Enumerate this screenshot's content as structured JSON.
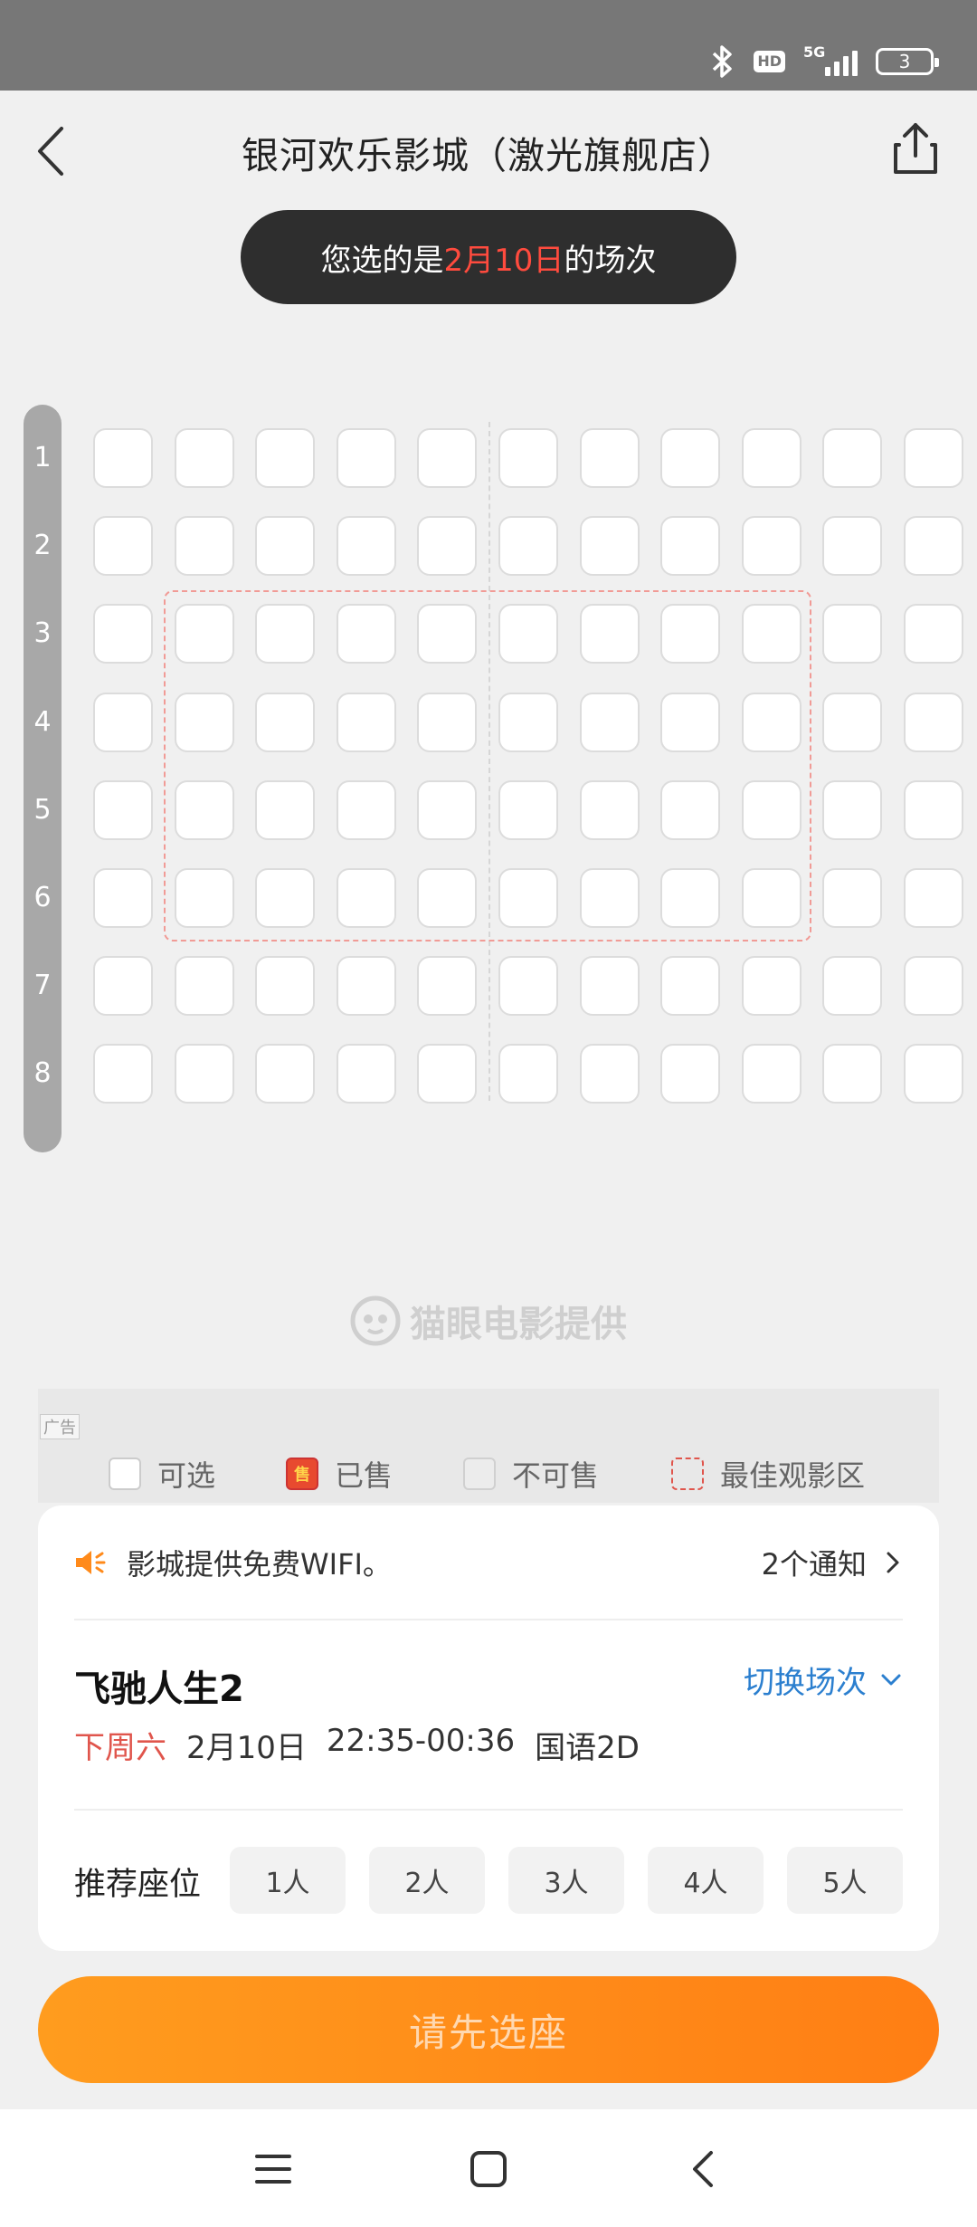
{
  "status": {
    "hd": "HD",
    "network": "5G",
    "battery": "3",
    "signal_icon": "signal-bars-icon",
    "bluetooth_icon": "bluetooth-icon"
  },
  "header": {
    "title": "银河欢乐影城（激光旗舰店）",
    "back_icon": "back-arrow-icon",
    "share_icon": "share-icon"
  },
  "date_notice": {
    "prefix": "您选的是",
    "date": "2月10日",
    "suffix": "的场次"
  },
  "seat_map": {
    "rows": [
      "1",
      "2",
      "3",
      "4",
      "5",
      "6",
      "7",
      "8"
    ],
    "seats_per_row": 11,
    "best_area_rows": [
      "3",
      "4",
      "5",
      "6"
    ],
    "best_area_seat_range": [
      2,
      9
    ]
  },
  "watermark": "猫眼电影提供",
  "ad_label": "广告",
  "legend": {
    "available": "可选",
    "sold": "已售",
    "sold_badge": "售",
    "unavailable": "不可售",
    "best": "最佳观影区"
  },
  "notice": {
    "text": "影城提供免费WIFI。",
    "count": "2个通知"
  },
  "movie": {
    "title": "飞驰人生2",
    "switch_label": "切换场次",
    "day": "下周六",
    "date": "2月10日",
    "time": "22:35-00:36",
    "format": "国语2D"
  },
  "recommend": {
    "label": "推荐座位",
    "options": [
      "1人",
      "2人",
      "3人",
      "4人",
      "5人"
    ]
  },
  "cta": "请先选座",
  "colors": {
    "accent_orange": "#ff8a1a",
    "highlight_red": "#ff4b3e",
    "link_blue": "#2b7fcf"
  }
}
